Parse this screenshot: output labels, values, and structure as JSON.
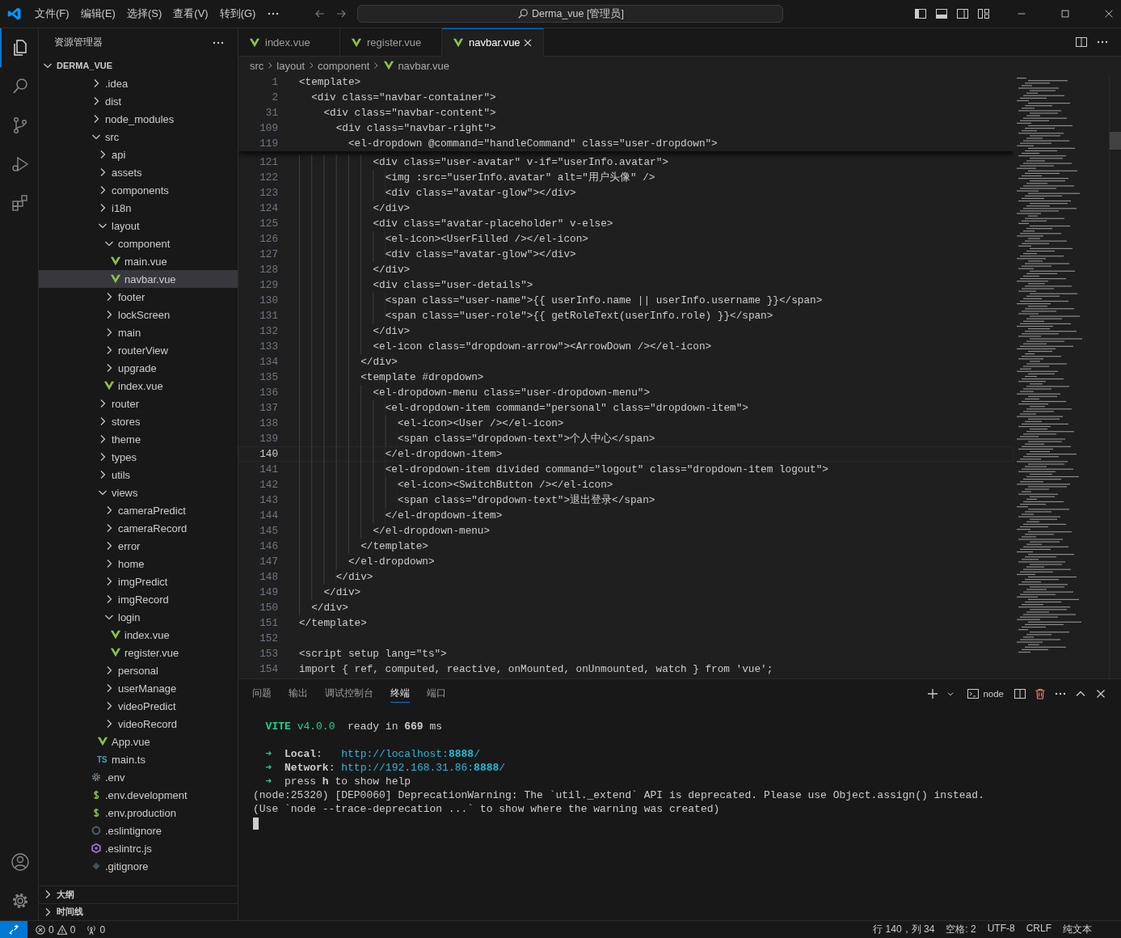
{
  "title_bar": {
    "menu": [
      "文件(F)",
      "编辑(E)",
      "选择(S)",
      "查看(V)",
      "转到(G)"
    ],
    "search": {
      "value": "Derma_vue [管理员]"
    }
  },
  "activity_bar": {
    "items": [
      {
        "kind": "files",
        "selected": true
      },
      {
        "kind": "search",
        "selected": false
      },
      {
        "kind": "scm",
        "selected": false
      },
      {
        "kind": "debug",
        "selected": false
      },
      {
        "kind": "extensions",
        "selected": false
      }
    ]
  },
  "explorer": {
    "title": "资源管理器",
    "root": {
      "name": "DERMA_VUE",
      "expanded": true
    },
    "tree": [
      {
        "name": ".idea",
        "kind": "folder",
        "expanded": false,
        "selected": false
      },
      {
        "name": "dist",
        "kind": "folder",
        "expanded": false,
        "selected": false
      },
      {
        "name": "node_modules",
        "kind": "folder",
        "expanded": false,
        "selected": false
      },
      {
        "name": "src",
        "kind": "folder",
        "expanded": true,
        "selected": false,
        "children": [
          {
            "name": "api",
            "kind": "folder",
            "expanded": false,
            "selected": false
          },
          {
            "name": "assets",
            "kind": "folder",
            "expanded": false,
            "selected": false
          },
          {
            "name": "components",
            "kind": "folder",
            "expanded": false,
            "selected": false
          },
          {
            "name": "i18n",
            "kind": "folder",
            "expanded": false,
            "selected": false
          },
          {
            "name": "layout",
            "kind": "folder",
            "expanded": true,
            "selected": false,
            "children": [
              {
                "name": "component",
                "kind": "folder",
                "expanded": true,
                "selected": false,
                "children": [
                  {
                    "name": "main.vue",
                    "kind": "vue",
                    "selected": false
                  },
                  {
                    "name": "navbar.vue",
                    "kind": "vue",
                    "selected": true
                  }
                ]
              },
              {
                "name": "footer",
                "kind": "folder",
                "expanded": false,
                "selected": false
              },
              {
                "name": "lockScreen",
                "kind": "folder",
                "expanded": false,
                "selected": false
              },
              {
                "name": "main",
                "kind": "folder",
                "expanded": false,
                "selected": false
              },
              {
                "name": "routerView",
                "kind": "folder",
                "expanded": false,
                "selected": false
              },
              {
                "name": "upgrade",
                "kind": "folder",
                "expanded": false,
                "selected": false
              },
              {
                "name": "index.vue",
                "kind": "vue",
                "selected": false
              }
            ]
          },
          {
            "name": "router",
            "kind": "folder",
            "expanded": false,
            "selected": false
          },
          {
            "name": "stores",
            "kind": "folder",
            "expanded": false,
            "selected": false
          },
          {
            "name": "theme",
            "kind": "folder",
            "expanded": false,
            "selected": false
          },
          {
            "name": "types",
            "kind": "folder",
            "expanded": false,
            "selected": false
          },
          {
            "name": "utils",
            "kind": "folder",
            "expanded": false,
            "selected": false
          },
          {
            "name": "views",
            "kind": "folder",
            "expanded": true,
            "selected": false,
            "children": [
              {
                "name": "cameraPredict",
                "kind": "folder",
                "expanded": false,
                "selected": false
              },
              {
                "name": "cameraRecord",
                "kind": "folder",
                "expanded": false,
                "selected": false
              },
              {
                "name": "error",
                "kind": "folder",
                "expanded": false,
                "selected": false
              },
              {
                "name": "home",
                "kind": "folder",
                "expanded": false,
                "selected": false
              },
              {
                "name": "imgPredict",
                "kind": "folder",
                "expanded": false,
                "selected": false
              },
              {
                "name": "imgRecord",
                "kind": "folder",
                "expanded": false,
                "selected": false
              },
              {
                "name": "login",
                "kind": "folder",
                "expanded": true,
                "selected": false,
                "children": [
                  {
                    "name": "index.vue",
                    "kind": "vue",
                    "selected": false
                  },
                  {
                    "name": "register.vue",
                    "kind": "vue",
                    "selected": false
                  }
                ]
              },
              {
                "name": "personal",
                "kind": "folder",
                "expanded": false,
                "selected": false
              },
              {
                "name": "userManage",
                "kind": "folder",
                "expanded": false,
                "selected": false
              },
              {
                "name": "videoPredict",
                "kind": "folder",
                "expanded": false,
                "selected": false
              },
              {
                "name": "videoRecord",
                "kind": "folder",
                "expanded": false,
                "selected": false
              }
            ]
          },
          {
            "name": "App.vue",
            "kind": "vue",
            "selected": false
          },
          {
            "name": "main.ts",
            "kind": "ts",
            "icon_text": "TS",
            "selected": false
          }
        ]
      },
      {
        "name": ".env",
        "kind": "gear",
        "selected": false
      },
      {
        "name": ".env.development",
        "kind": "dollar",
        "selected": false
      },
      {
        "name": ".env.production",
        "kind": "dollar",
        "selected": false
      },
      {
        "name": ".eslintignore",
        "kind": "ring",
        "selected": false
      },
      {
        "name": ".eslintrc.js",
        "kind": "eslint",
        "selected": false
      },
      {
        "name": ".gitignore",
        "kind": "git",
        "selected": false
      }
    ],
    "sections": [
      {
        "title": "大纲",
        "expanded": false
      },
      {
        "title": "时间线",
        "expanded": false
      }
    ]
  },
  "tabs": [
    {
      "label": "index.vue",
      "selected": false
    },
    {
      "label": "register.vue",
      "selected": false
    },
    {
      "label": "navbar.vue",
      "selected": true
    }
  ],
  "breadcrumbs": [
    "src",
    "layout",
    "component",
    "navbar.vue"
  ],
  "sticky_lines": [
    {
      "num": "1",
      "text": "<template>"
    },
    {
      "num": "2",
      "text": "  <div class=\"navbar-container\">"
    },
    {
      "num": "31",
      "text": "    <div class=\"navbar-content\">"
    },
    {
      "num": "109",
      "text": "      <div class=\"navbar-right\">"
    },
    {
      "num": "119",
      "text": "        <el-dropdown @command=\"handleCommand\" class=\"user-dropdown\">"
    }
  ],
  "code_lines": [
    {
      "num": "121",
      "text": "            <div class=\"user-avatar\" v-if=\"userInfo.avatar\">",
      "current": false
    },
    {
      "num": "122",
      "text": "              <img :src=\"userInfo.avatar\" alt=\"用户头像\" />",
      "current": false
    },
    {
      "num": "123",
      "text": "              <div class=\"avatar-glow\"></div>",
      "current": false
    },
    {
      "num": "124",
      "text": "            </div>",
      "current": false
    },
    {
      "num": "125",
      "text": "            <div class=\"avatar-placeholder\" v-else>",
      "current": false
    },
    {
      "num": "126",
      "text": "              <el-icon><UserFilled /></el-icon>",
      "current": false
    },
    {
      "num": "127",
      "text": "              <div class=\"avatar-glow\"></div>",
      "current": false
    },
    {
      "num": "128",
      "text": "            </div>",
      "current": false
    },
    {
      "num": "129",
      "text": "            <div class=\"user-details\">",
      "current": false
    },
    {
      "num": "130",
      "text": "              <span class=\"user-name\">{{ userInfo.name || userInfo.username }}</span>",
      "current": false
    },
    {
      "num": "131",
      "text": "              <span class=\"user-role\">{{ getRoleText(userInfo.role) }}</span>",
      "current": false
    },
    {
      "num": "132",
      "text": "            </div>",
      "current": false
    },
    {
      "num": "133",
      "text": "            <el-icon class=\"dropdown-arrow\"><ArrowDown /></el-icon>",
      "current": false
    },
    {
      "num": "134",
      "text": "          </div>",
      "current": false
    },
    {
      "num": "135",
      "text": "          <template #dropdown>",
      "current": false
    },
    {
      "num": "136",
      "text": "            <el-dropdown-menu class=\"user-dropdown-menu\">",
      "current": false
    },
    {
      "num": "137",
      "text": "              <el-dropdown-item command=\"personal\" class=\"dropdown-item\">",
      "current": false
    },
    {
      "num": "138",
      "text": "                <el-icon><User /></el-icon>",
      "current": false
    },
    {
      "num": "139",
      "text": "                <span class=\"dropdown-text\">个人中心</span>",
      "current": false
    },
    {
      "num": "140",
      "text": "              </el-dropdown-item>",
      "current": true
    },
    {
      "num": "141",
      "text": "              <el-dropdown-item divided command=\"logout\" class=\"dropdown-item logout\">",
      "current": false
    },
    {
      "num": "142",
      "text": "                <el-icon><SwitchButton /></el-icon>",
      "current": false
    },
    {
      "num": "143",
      "text": "                <span class=\"dropdown-text\">退出登录</span>",
      "current": false
    },
    {
      "num": "144",
      "text": "              </el-dropdown-item>",
      "current": false
    },
    {
      "num": "145",
      "text": "            </el-dropdown-menu>",
      "current": false
    },
    {
      "num": "146",
      "text": "          </template>",
      "current": false
    },
    {
      "num": "147",
      "text": "        </el-dropdown>",
      "current": false
    },
    {
      "num": "148",
      "text": "      </div>",
      "current": false
    },
    {
      "num": "149",
      "text": "    </div>",
      "current": false
    },
    {
      "num": "150",
      "text": "  </div>",
      "current": false
    },
    {
      "num": "151",
      "text": "</template>",
      "current": false
    },
    {
      "num": "152",
      "current": false
    },
    {
      "num": "153",
      "text": "<script setup lang=\"ts\">",
      "current": false
    },
    {
      "num": "154",
      "text": "import { ref, computed, reactive, onMounted, onUnmounted, watch } from 'vue';",
      "current": false
    }
  ],
  "panel": {
    "tabs": [
      {
        "label": "问题",
        "selected": false
      },
      {
        "label": "输出",
        "selected": false
      },
      {
        "label": "调试控制台",
        "selected": false
      },
      {
        "label": "终端",
        "selected": true
      },
      {
        "label": "端口",
        "selected": false
      }
    ],
    "terminal_name": "node",
    "terminal_lines": [
      {
        "segments": [
          {
            "kind": "green",
            "text": "  **VITE** v4.0.0"
          },
          {
            "kind": "plain",
            "text": "  ready in **669** ms"
          }
        ]
      },
      {
        "segments": [
          {
            "kind": "green",
            "text": "  ➜"
          },
          {
            "kind": "plain",
            "text": "  **Local**:   "
          },
          {
            "kind": "link",
            "text": "http://localhost:**8888**/"
          }
        ]
      },
      {
        "segments": [
          {
            "kind": "green",
            "text": "  ➜"
          },
          {
            "kind": "plain",
            "text": "  **Network**: "
          },
          {
            "kind": "link",
            "text": "http://192.168.31.86:**8888**/"
          }
        ]
      },
      {
        "segments": [
          {
            "kind": "green",
            "text": "  ➜"
          },
          {
            "kind": "plain",
            "text": "  press **h** to show help"
          }
        ]
      },
      {
        "segments": [
          {
            "kind": "plain",
            "text": "(node:25320) [DEP0060] DeprecationWarning: The `util._extend` API is deprecated. Please use Object.assign() instead."
          }
        ]
      },
      {
        "segments": [
          {
            "kind": "plain",
            "text": "(Use `node --trace-deprecation ...` to show where the warning was created)"
          }
        ]
      }
    ]
  },
  "status_bar": {
    "errors": "0",
    "warnings": "0",
    "ports": "0",
    "right": [
      "行 140，列 34",
      "空格: 2",
      "UTF-8",
      "CRLF",
      "纯文本"
    ]
  }
}
